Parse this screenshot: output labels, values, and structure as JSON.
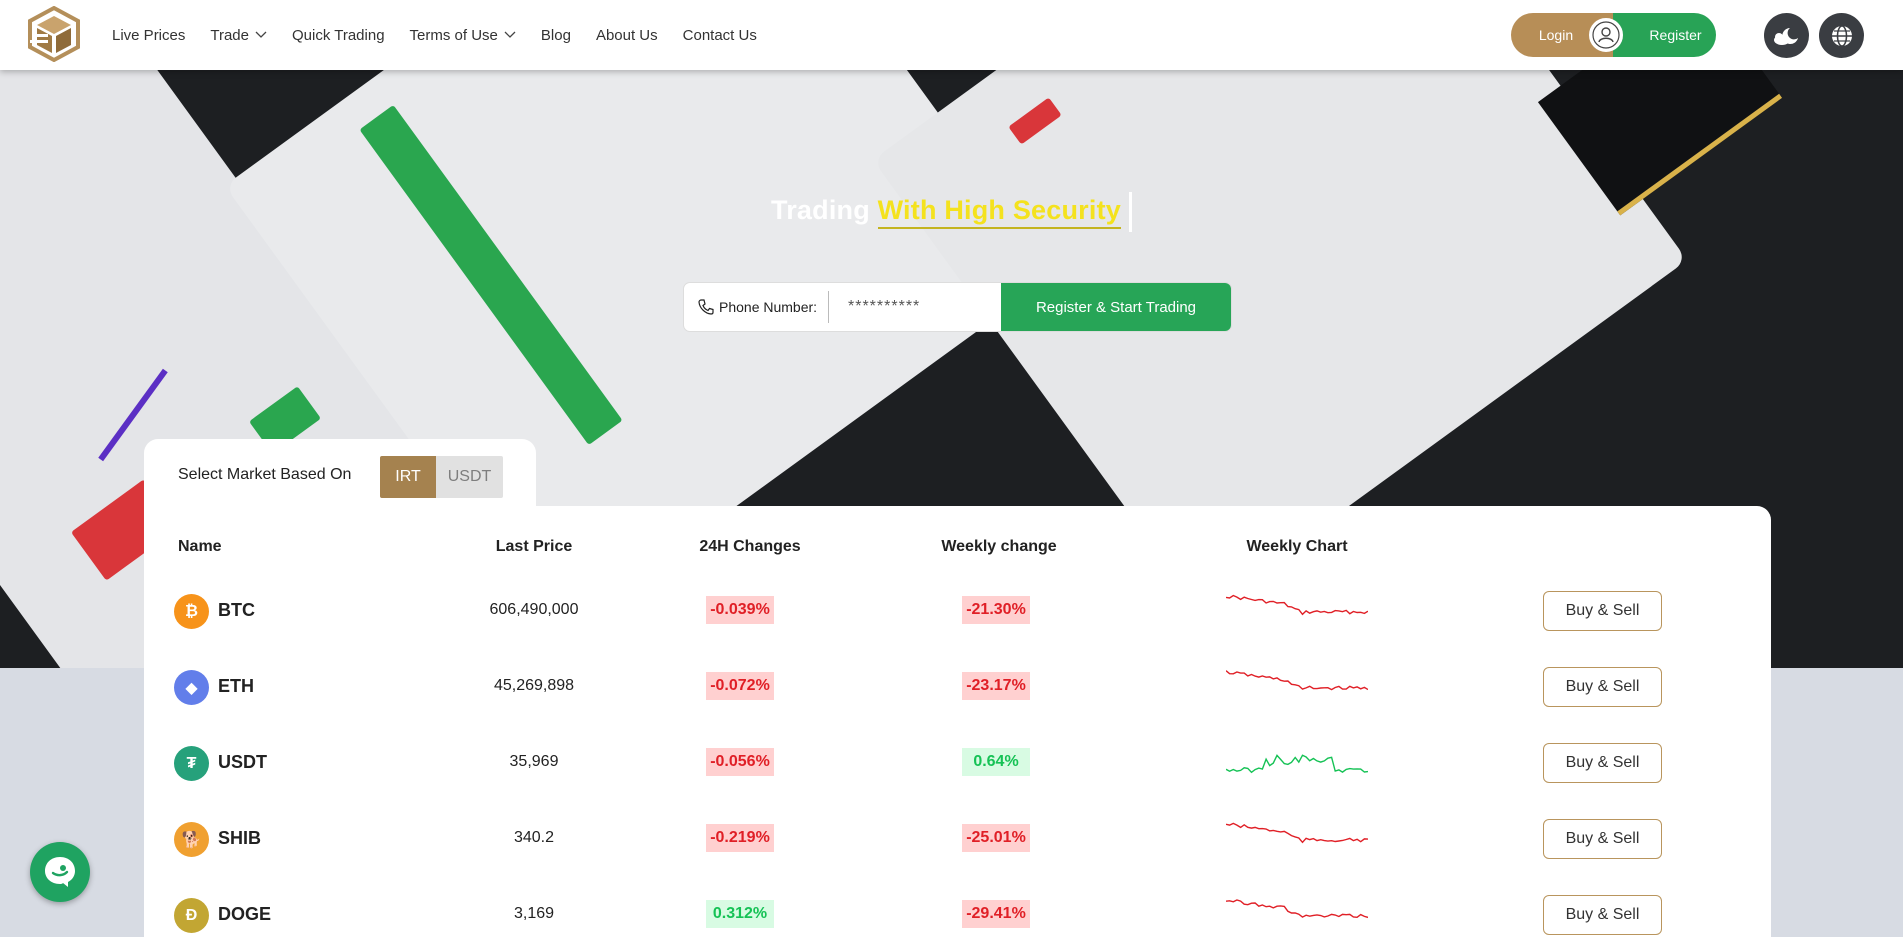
{
  "nav": {
    "items": [
      {
        "label": "Live Prices",
        "dropdown": false
      },
      {
        "label": "Trade",
        "dropdown": true
      },
      {
        "label": "Quick Trading",
        "dropdown": false
      },
      {
        "label": "Terms of Use",
        "dropdown": true
      },
      {
        "label": "Blog",
        "dropdown": false
      },
      {
        "label": "About Us",
        "dropdown": false
      },
      {
        "label": "Contact Us",
        "dropdown": false
      }
    ],
    "login_label": "Login",
    "register_label": "Register"
  },
  "hero": {
    "title_plain": "Trading ",
    "title_highlight": "With High Security",
    "phone_label": "Phone Number:",
    "phone_placeholder": "**********",
    "cta_label": "Register & Start Trading"
  },
  "market": {
    "select_label": "Select Market Based On",
    "options": [
      "IRT",
      "USDT"
    ],
    "selected": "IRT",
    "columns": [
      "Name",
      "Last Price",
      "24H Changes",
      "Weekly change",
      "Weekly Chart"
    ],
    "rows": [
      {
        "symbol": "BTC",
        "price": "606,490,000",
        "change_24h": "-0.039%",
        "change_weekly": "-21.30%",
        "trend": "down",
        "icon": "bitcoin-icon",
        "color": "#f7931a",
        "glyph": "₿",
        "action": "Buy & Sell"
      },
      {
        "symbol": "ETH",
        "price": "45,269,898",
        "change_24h": "-0.072%",
        "change_weekly": "-23.17%",
        "trend": "down",
        "icon": "ethereum-icon",
        "color": "#627eea",
        "glyph": "◆",
        "action": "Buy & Sell"
      },
      {
        "symbol": "USDT",
        "price": "35,969",
        "change_24h": "-0.056%",
        "change_weekly": "0.64%",
        "trend": "up",
        "icon": "tether-icon",
        "color": "#26a17b",
        "glyph": "₮",
        "action": "Buy & Sell"
      },
      {
        "symbol": "SHIB",
        "price": "340.2",
        "change_24h": "-0.219%",
        "change_weekly": "-25.01%",
        "trend": "down",
        "icon": "shiba-icon",
        "color": "#f0a030",
        "glyph": "🐕",
        "action": "Buy & Sell"
      },
      {
        "symbol": "DOGE",
        "price": "3,169",
        "change_24h": "0.312%",
        "change_weekly": "-29.41%",
        "trend": "down",
        "icon": "dogecoin-icon",
        "color": "#c2a633",
        "glyph": "Ð",
        "action": "Buy & Sell"
      }
    ]
  },
  "colors": {
    "accent_gold": "#b78e57",
    "accent_green": "#28a356",
    "negative": "#e01f26",
    "positive": "#15c255"
  }
}
